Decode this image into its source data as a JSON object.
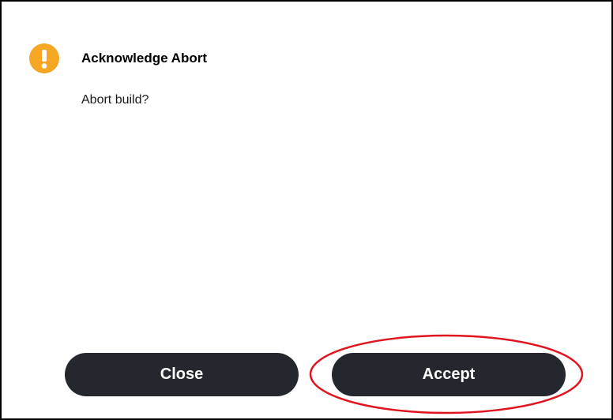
{
  "dialog": {
    "title": "Acknowledge Abort",
    "message": "Abort build?",
    "icon": "warning-icon",
    "icon_color": "#f5a623"
  },
  "buttons": {
    "close_label": "Close",
    "accept_label": "Accept",
    "button_color": "#25272e"
  },
  "annotation": {
    "highlight_color": "#e0141e",
    "highlighted": "accept-button"
  }
}
